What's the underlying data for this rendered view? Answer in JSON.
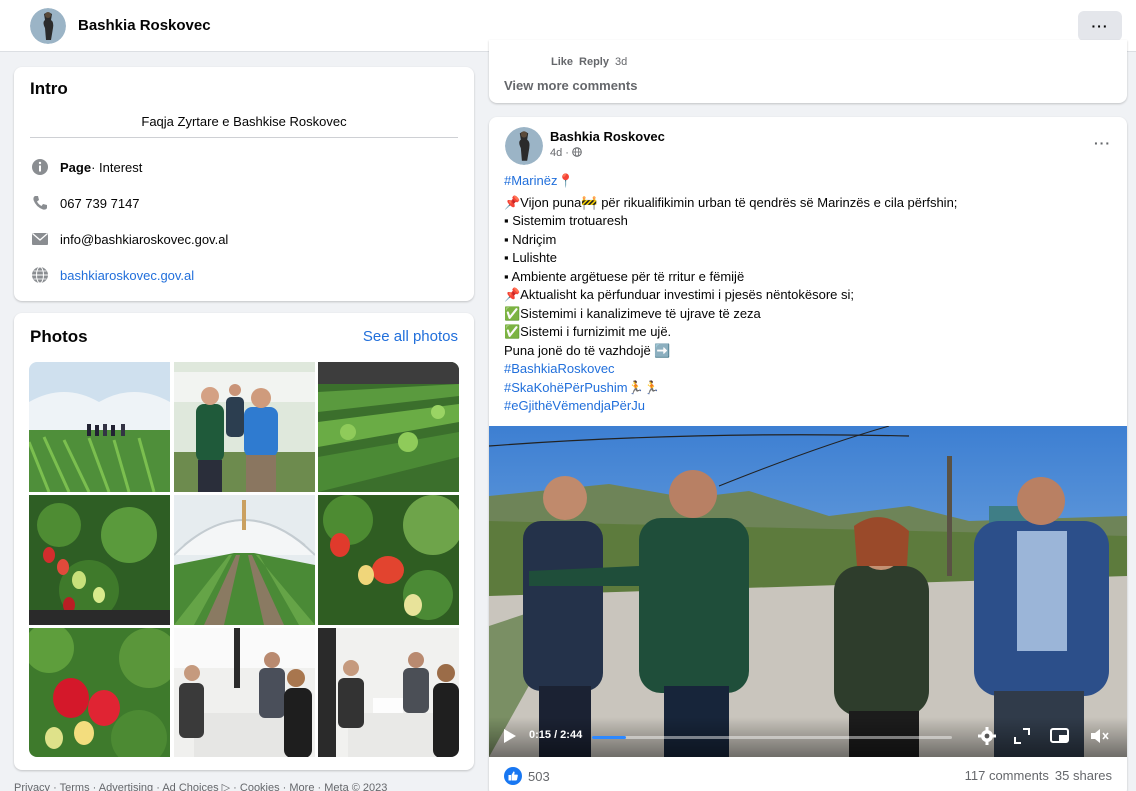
{
  "header": {
    "page_name": "Bashkia Roskovec",
    "more_label": "···"
  },
  "comments": {
    "like_label": "Like",
    "reply_label": "Reply",
    "time": "3d",
    "view_more": "View more comments"
  },
  "intro": {
    "title": "Intro",
    "bio": "Faqja Zyrtare e Bashkise Roskovec",
    "category_bold": "Page",
    "category_rest": " · Interest",
    "phone": "067 739 7147",
    "email": "info@bashkiaroskovec.gov.al",
    "website": "bashkiaroskovec.gov.al"
  },
  "photos": {
    "title": "Photos",
    "see_all": "See all photos"
  },
  "footer": {
    "links": "Privacy · Terms · Advertising · Ad Choices ▷ · Cookies · More · Meta © 2023"
  },
  "post": {
    "author": "Bashkia Roskovec",
    "meta": "4d · ",
    "more_label": "···",
    "lines": {
      "l1": "#Marinëz📍",
      "l2": "📌Vijon puna🚧 për rikualifikimin urban të qendrës së Marinzës e cila përfshin;",
      "l3": "▪ Sistemim trotuaresh",
      "l4": "▪ Ndriçim",
      "l5": "▪ Lulishte",
      "l6": "▪ Ambiente argëtuese për të rritur e fëmijë",
      "l7": "📌Aktualisht ka përfunduar investimi i pjesës nëntokësore si;",
      "l8": "✅Sistemimi i kanalizimeve të ujrave të zeza",
      "l9": "✅Sistemi i furnizimit me ujë.",
      "l10": "Puna jonë do të vazhdojë ➡️",
      "h1": "#BashkiaRoskovec",
      "h2": "#SkaKohëPërPushim🏃🏃",
      "h3": "#eGjithëVëmendjaPërJu"
    },
    "video": {
      "time": "0:15 / 2:44",
      "progress": 0.095
    },
    "reactions_count": "503",
    "comments_count": "117 comments",
    "shares_count": "35 shares"
  },
  "icons": {
    "info": "info-icon",
    "phone": "phone-icon",
    "email": "email-icon",
    "website": "globe-icon",
    "globe_small": "globe-small-icon",
    "like": "like-badge-icon",
    "play": "play-icon",
    "settings": "gear-icon",
    "fullscreen": "fullscreen-icon",
    "pip": "picture-in-picture-icon",
    "mute": "volume-mute-icon"
  },
  "colors": {
    "link": "#216fdb",
    "progress": "#2d88ff",
    "muted_text": "#65676b"
  }
}
